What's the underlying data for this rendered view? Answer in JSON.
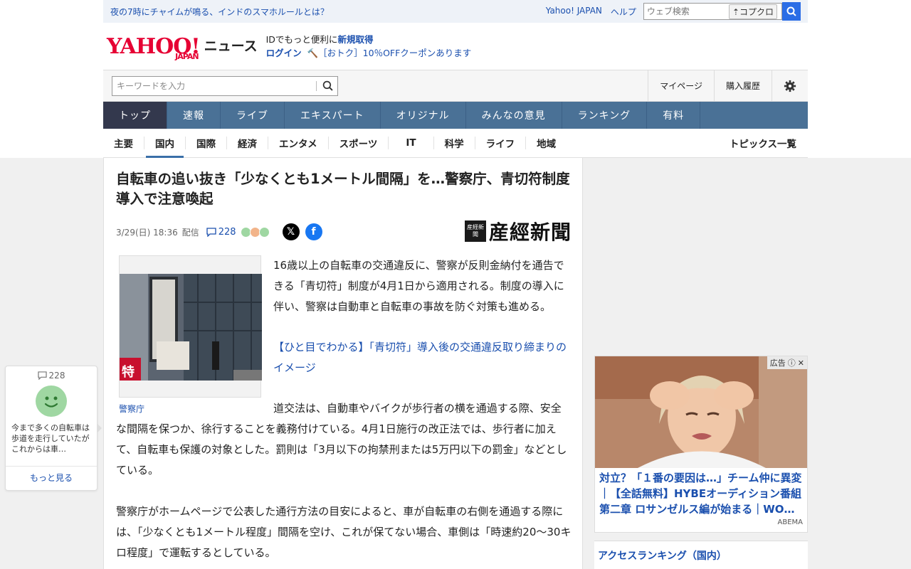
{
  "header": {
    "promo_link": "夜の7時にチャイムが鳴る、インドのスマホルールとは？",
    "yahoo_japan_link": "Yahoo! JAPAN",
    "help_link": "ヘルプ",
    "web_search_placeholder": "ウェブ検索",
    "kopukuro_label": "コプクロ",
    "logo_text": "YAHOO!",
    "logo_sub": "JAPAN",
    "news_label": "ニュース",
    "id_prompt": "IDでもっと便利に",
    "id_register": "新規取得",
    "login": "ログイン",
    "coupon": "［おトク］10％OFFクーポンあります"
  },
  "search": {
    "keyword_placeholder": "キーワードを入力",
    "mypage": "マイページ",
    "purchase_history": "購入履歴"
  },
  "global_nav": [
    "トップ",
    "速報",
    "ライブ",
    "エキスパート",
    "オリジナル",
    "みんなの意見",
    "ランキング",
    "有料"
  ],
  "sub_nav": [
    "主要",
    "国内",
    "国際",
    "経済",
    "エンタメ",
    "スポーツ",
    "IT",
    "科学",
    "ライフ",
    "地域"
  ],
  "sub_nav_active": "国内",
  "topics_list": "トピックス一覧",
  "article": {
    "title": "自転車の追い抜き「少なくとも1メートル間隔」を…警察庁、青切符制度導入で注意喚起",
    "date": "3/29(日) 18:36",
    "delivery": "配信",
    "comment_count": "228",
    "publisher": "産經新聞",
    "publisher_mark": "産経新聞",
    "photo_caption": "警察庁",
    "paragraph1": "16歳以上の自転車の交通違反に、警察が反則金納付を通告できる「青切符」制度が4月1日から適用される。制度の導入に伴い、警察は自動車と自転車の事故を防ぐ対策も進める。",
    "related_link": "【ひと目でわかる】「青切符」導入後の交通違反取り締まりのイメージ",
    "paragraph2": "道交法は、自動車やバイクが歩行者の横を通過する際、安全な間隔を保つか、徐行することを義務付けている。4月1日施行の改正法では、歩行者に加えて、自転車も保護の対象とした。罰則は「3月以下の拘禁刑または5万円以下の罰金」などとしている。",
    "paragraph3": "警察庁がホームページで公表した通行方法の目安によると、車が自転車の右側を通過する際には、「少なくとも1メートル程度」間隔を空け、これが保てない場合、車側は「時速約20～30キロ程度」で運転するとしている。"
  },
  "comment_float": {
    "count": "228",
    "text": "今まで多くの自転車は歩道を走行していたが これからは車…",
    "more": "もっと見る"
  },
  "ad": {
    "label": "広告",
    "headline": "対立？「１番の要因は…」チーム仲に異変｜【全話無料】HYBEオーディション番組 第二章 ロサンゼルス編が始まる｜WO…",
    "sponsor": "ABEMA"
  },
  "ranking_title": "アクセスランキング（国内）",
  "colors": {
    "nav_bg": "#4a7196",
    "nav_active": "#33384d",
    "link": "#1a4fae",
    "yahoo_red": "#e60033"
  }
}
